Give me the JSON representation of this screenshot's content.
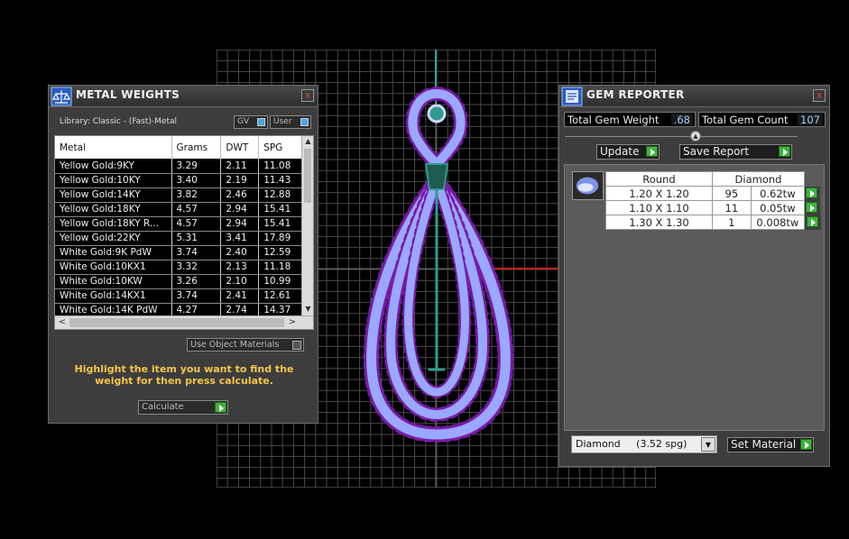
{
  "metal_weights": {
    "title": "METAL WEIGHTS",
    "close": "x",
    "library_label": "Library: Classic - (Fast)-Metal",
    "toggle_gv": "GV",
    "toggle_user": "User",
    "columns": [
      "Metal",
      "Grams",
      "DWT",
      "SPG"
    ],
    "rows": [
      [
        "Yellow Gold:9KY",
        "3.29",
        "2.11",
        "11.08"
      ],
      [
        "Yellow Gold:10KY",
        "3.40",
        "2.19",
        "11.43"
      ],
      [
        "Yellow Gold:14KY",
        "3.82",
        "2.46",
        "12.88"
      ],
      [
        "Yellow Gold:18KY",
        "4.57",
        "2.94",
        "15.41"
      ],
      [
        "Yellow Gold:18KY R...",
        "4.57",
        "2.94",
        "15.41"
      ],
      [
        "Yellow Gold:22KY",
        "5.31",
        "3.41",
        "17.89"
      ],
      [
        "White Gold:9K PdW",
        "3.74",
        "2.40",
        "12.59"
      ],
      [
        "White Gold:10KX1",
        "3.32",
        "2.13",
        "11.18"
      ],
      [
        "White Gold:10KW",
        "3.26",
        "2.10",
        "10.99"
      ],
      [
        "White Gold:14KX1",
        "3.74",
        "2.41",
        "12.61"
      ],
      [
        "White Gold:14K PdW",
        "4.27",
        "2.74",
        "14.37"
      ]
    ],
    "use_object_materials": "Use Object Materials",
    "help_text": "Highlight the item you want to find the weight for then press calculate.",
    "calculate_label": "Calculate"
  },
  "gem_reporter": {
    "title": "GEM REPORTER",
    "close": "x",
    "total_weight_label": "Total Gem Weight",
    "total_weight_value": ".68",
    "total_count_label": "Total Gem Count",
    "total_count_value": "107",
    "update_label": "Update",
    "save_report_label": "Save Report",
    "table_headers": [
      "Round",
      "Diamond"
    ],
    "table_rows": [
      [
        "1.20 X 1.20",
        "95",
        "0.62tw"
      ],
      [
        "1.10 X 1.10",
        "11",
        "0.05tw"
      ],
      [
        "1.30 X 1.30",
        "1",
        "0.008tw"
      ]
    ],
    "material_value": "Diamond     (3.52 spg)",
    "set_material_label": "Set Material"
  },
  "colors": {
    "background": "#000000",
    "grid_line": "#5a5a5a",
    "gem_fill": "#9aa8ff",
    "prong": "#7a1aa8",
    "accent_yellow": "#f6c54a",
    "go_green": "#3fb33f"
  }
}
